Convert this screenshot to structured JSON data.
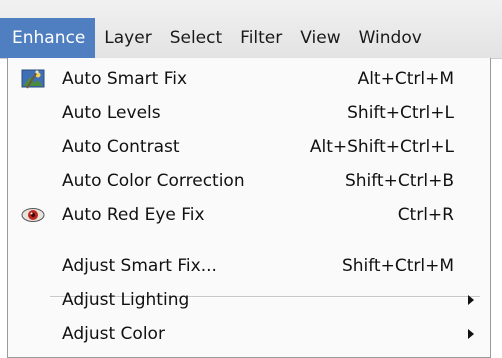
{
  "menubar": {
    "items": [
      {
        "label": "Enhance",
        "active": true
      },
      {
        "label": "Layer"
      },
      {
        "label": "Select"
      },
      {
        "label": "Filter"
      },
      {
        "label": "View"
      },
      {
        "label": "Windov"
      }
    ]
  },
  "enhance_menu": {
    "items": [
      {
        "label": "Auto Smart Fix",
        "shortcut": "Alt+Ctrl+M",
        "icon": "auto-smart-fix-icon"
      },
      {
        "label": "Auto Levels",
        "shortcut": "Shift+Ctrl+L"
      },
      {
        "label": "Auto Contrast",
        "shortcut": "Alt+Shift+Ctrl+L"
      },
      {
        "label": "Auto Color Correction",
        "shortcut": "Shift+Ctrl+B"
      },
      {
        "label": "Auto Red Eye Fix",
        "shortcut": "Ctrl+R",
        "icon": "red-eye-icon"
      },
      {
        "label": "Adjust Smart Fix...",
        "shortcut": "Shift+Ctrl+M"
      },
      {
        "label": "Adjust Lighting",
        "submenu": true
      },
      {
        "label": "Adjust Color",
        "submenu": true
      }
    ]
  },
  "colors": {
    "active_menu_bg": "#4f7fc0",
    "menu_bg": "#fafafa",
    "menubar_bg": "#e8e8e8"
  }
}
